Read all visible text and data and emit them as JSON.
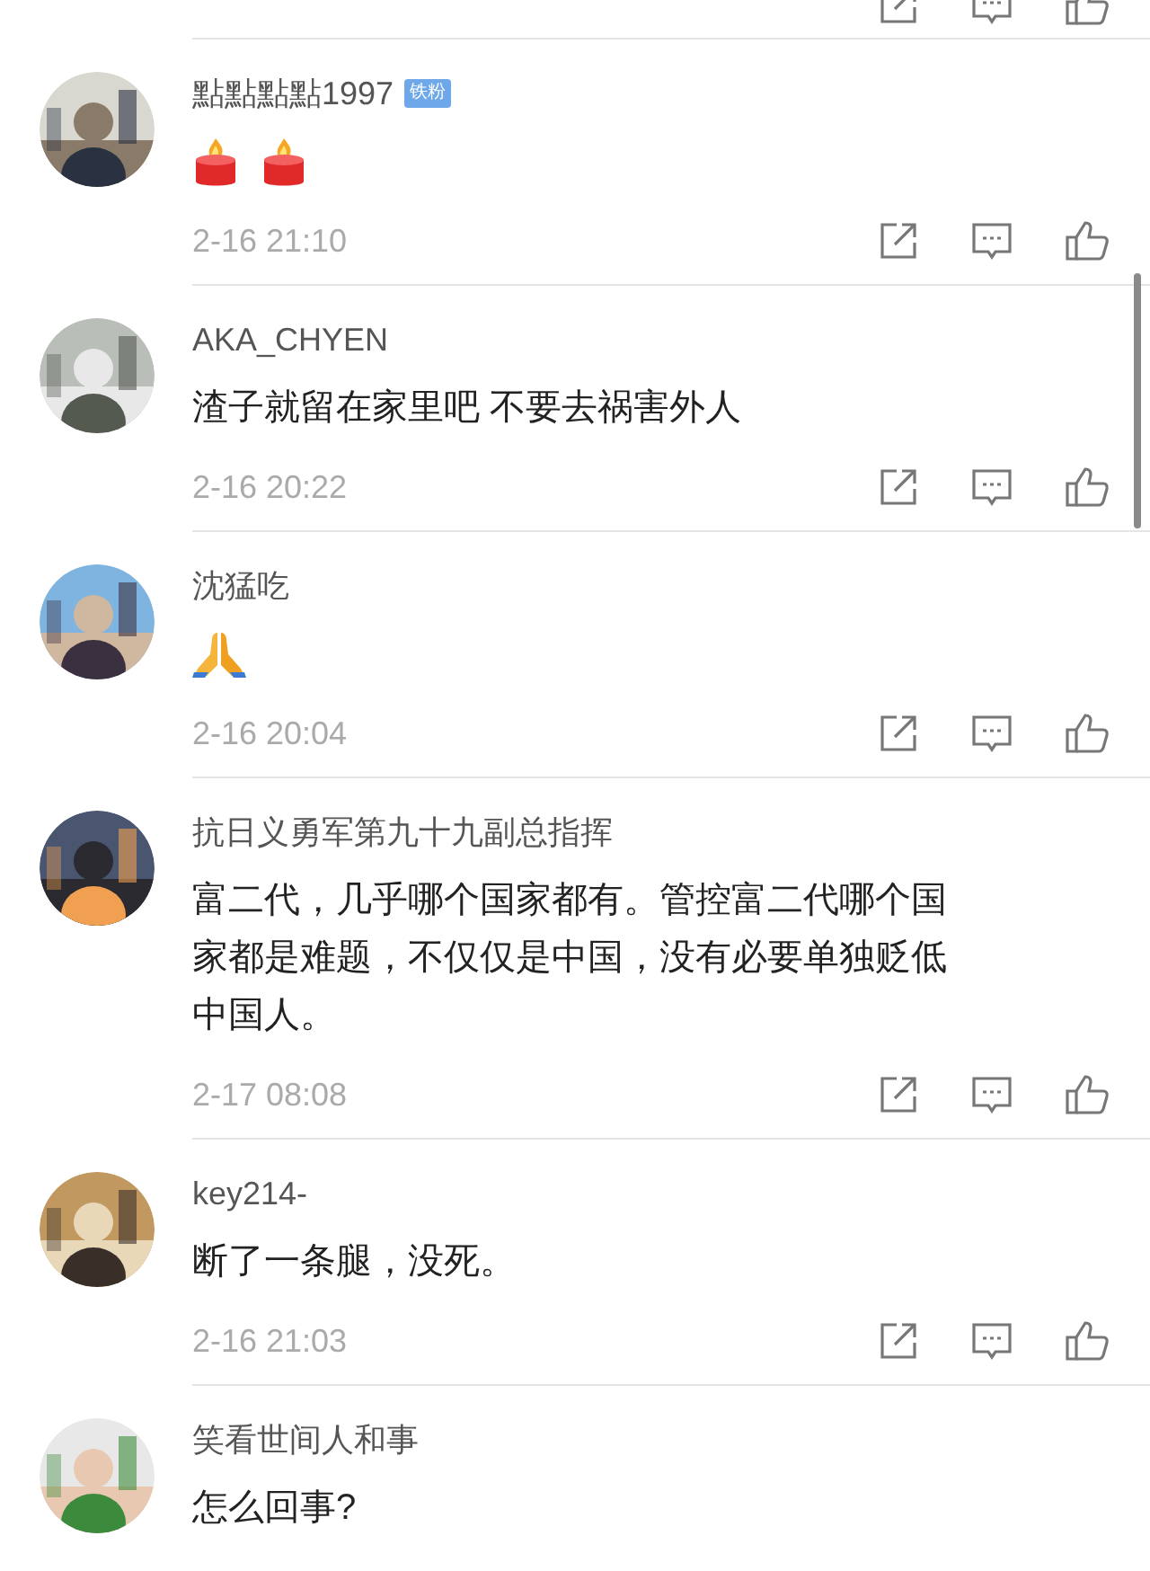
{
  "comments": [
    {
      "name": "點點點點1997",
      "badge": "铁粉",
      "content": {
        "kind": "icons",
        "icons": [
          {
            "kind": "candle"
          },
          {
            "kind": "candle"
          }
        ]
      },
      "time": "2-16 21:10"
    },
    {
      "name": "AKA_CHYEN",
      "content": {
        "kind": "text",
        "lines": [
          "渣子就留在家里吧 不要去祸害外人"
        ]
      },
      "time": "2-16 20:22"
    },
    {
      "name": "沈猛吃",
      "content": {
        "kind": "icons",
        "icons": [
          {
            "kind": "praying-hands"
          }
        ]
      },
      "time": "2-16 20:04"
    },
    {
      "name": "抗日义勇军第九十九副总指挥",
      "content": {
        "kind": "text",
        "lines": [
          "富二代，几乎哪个国家都有。管控富二代哪个国",
          "家都是难题，不仅仅是中国，没有必要单独贬低",
          "中国人。"
        ]
      },
      "time": "2-17 08:08"
    },
    {
      "name": "key214-",
      "content": {
        "kind": "text",
        "lines": [
          "断了一条腿，没死。"
        ]
      },
      "time": "2-16 21:03"
    },
    {
      "name": "笑看世间人和事",
      "content": {
        "kind": "text",
        "lines": [
          "怎么回事?"
        ]
      }
    }
  ]
}
